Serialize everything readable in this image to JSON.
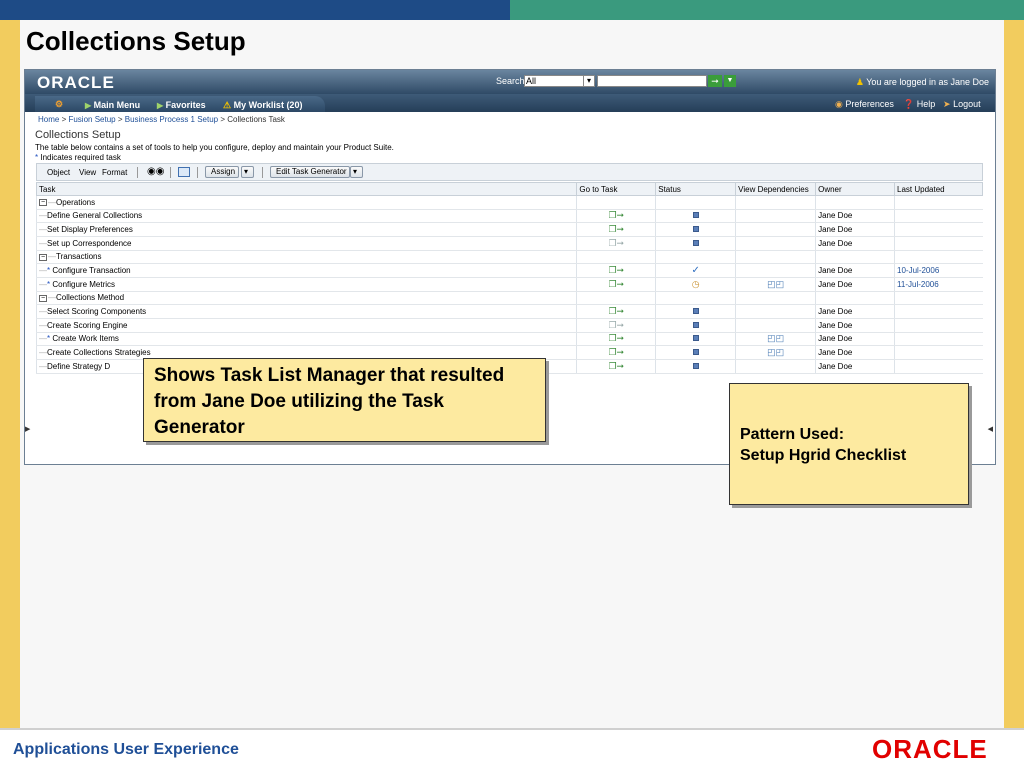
{
  "slide": {
    "title": "Collections Setup",
    "footer_text": "Applications User Experience",
    "footer_logo": "ORACLE"
  },
  "app": {
    "logo": "ORACLE",
    "search": {
      "label": "Search",
      "scope": "All"
    },
    "logged_in_text": "You are logged in as Jane Doe",
    "menu": {
      "main": "Main Menu",
      "favorites": "Favorites",
      "worklist": "My Worklist (20)"
    },
    "right_links": {
      "preferences": "Preferences",
      "help": "Help",
      "logout": "Logout"
    },
    "breadcrumb": [
      "Home",
      "Fusion Setup",
      "Business Process 1 Setup",
      "Collections Task"
    ],
    "page": {
      "heading": "Collections Setup",
      "description": "The table below contains a set of tools to help you configure, deploy and maintain your Product Suite.",
      "required_note": "Indicates required task"
    },
    "toolbar": {
      "object": "Object",
      "view": "View",
      "format": "Format",
      "assign": "Assign",
      "generator": "Edit Task Generator"
    },
    "grid": {
      "columns": [
        "Task",
        "Go to Task",
        "Status",
        "View Dependencies",
        "Owner",
        "Last Updated"
      ],
      "rows": [
        {
          "level": 0,
          "name": "Operations"
        },
        {
          "level": 1,
          "name": "Define General Collections",
          "owner": "Jane Doe",
          "status": "square"
        },
        {
          "level": 1,
          "name": "Set Display Preferences",
          "owner": "Jane Doe",
          "status": "square"
        },
        {
          "level": 1,
          "name": "Set up Correspondence",
          "owner": "Jane Doe",
          "status": "square"
        },
        {
          "level": 0,
          "name": "Transactions"
        },
        {
          "level": 1,
          "name": "Configure Transaction",
          "required": true,
          "owner": "Jane Doe",
          "status": "check",
          "updated": "10-Jul-2006"
        },
        {
          "level": 1,
          "name": "Configure Metrics",
          "required": true,
          "owner": "Jane Doe",
          "status": "clock",
          "dependencies": true,
          "updated": "11-Jul-2006"
        },
        {
          "level": 0,
          "name": "Collections Method"
        },
        {
          "level": 1,
          "name": "Select Scoring Components",
          "owner": "Jane Doe",
          "status": "square"
        },
        {
          "level": 1,
          "name": "Create Scoring Engine",
          "owner": "Jane Doe",
          "status": "square"
        },
        {
          "level": 1,
          "name": "Create Work Items",
          "required": true,
          "owner": "Jane Doe",
          "status": "square",
          "dependencies": true
        },
        {
          "level": 1,
          "name": "Create Collections Strategies",
          "owner": "Jane Doe",
          "status": "square",
          "dependencies": true
        },
        {
          "level": 1,
          "name": "Define Strategy D",
          "owner": "Jane Doe",
          "status": "square"
        }
      ]
    }
  },
  "callouts": {
    "task_list": "Shows Task List Manager that resulted from Jane Doe utilizing the Task Generator",
    "pattern_label": "Pattern Used:",
    "pattern_value": "Setup Hgrid Checklist"
  },
  "colors": {
    "header_blue": "#1e4b86",
    "header_green": "#3a9a7e",
    "gold": "#f2cc5e",
    "callout": "#fdeaa0"
  }
}
